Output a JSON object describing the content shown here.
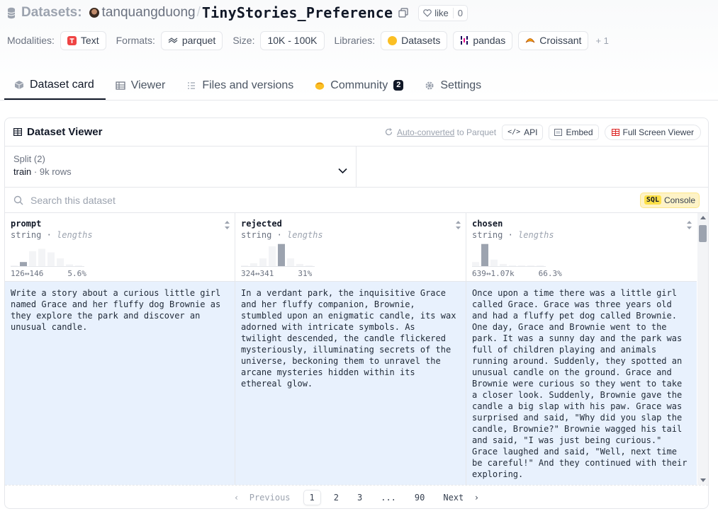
{
  "header": {
    "crumb_label": "Datasets:",
    "owner": "tanquangduong",
    "separator": "/",
    "repo": "TinyStories_Preference",
    "like_label": "like",
    "like_count": "0"
  },
  "meta": {
    "modalities_key": "Modalities:",
    "modalities": [
      "Text"
    ],
    "formats_key": "Formats:",
    "formats": [
      "parquet"
    ],
    "size_key": "Size:",
    "size": "10K - 100K",
    "libraries_key": "Libraries:",
    "libraries": [
      "Datasets",
      "pandas",
      "Croissant"
    ],
    "libraries_more": "+ 1"
  },
  "tabs": [
    {
      "label": "Dataset card",
      "icon": "cube-icon",
      "active": true
    },
    {
      "label": "Viewer",
      "icon": "table-icon"
    },
    {
      "label": "Files and versions",
      "icon": "files-icon"
    },
    {
      "label": "Community",
      "icon": "community-icon",
      "badge": "2"
    },
    {
      "label": "Settings",
      "icon": "gear-icon"
    }
  ],
  "viewer": {
    "title": "Dataset Viewer",
    "auto_link": "Auto-converted",
    "auto_suffix": " to Parquet",
    "api_label": "API",
    "embed_label": "Embed",
    "fullscreen_label": "Full Screen Viewer",
    "split_label": "Split (2)",
    "split_value": "train",
    "split_sep": " · ",
    "split_rows": "9k rows",
    "search_placeholder": "Search this dataset",
    "sql_tag": "SQL",
    "sql_label": "Console"
  },
  "columns": [
    {
      "name": "prompt",
      "type": "string",
      "sub": "lengths",
      "range": "126↔146",
      "pct": "5.6%",
      "hist": [
        0.0,
        0.2,
        0.65,
        0.75,
        0.6,
        0.35,
        0.1,
        0.05
      ],
      "highlight": 1,
      "cell": "Write a story about a curious little girl named Grace and her fluffy dog Brownie as they explore the park and discover an unusual candle."
    },
    {
      "name": "rejected",
      "type": "string",
      "sub": "lengths",
      "range": "324↔341",
      "pct": "31%",
      "hist": [
        0.05,
        0.15,
        0.35,
        0.85,
        0.95,
        0.35,
        0.12,
        0.05
      ],
      "highlight": 4,
      "cell": "In a verdant park, the inquisitive Grace and her fluffy companion, Brownie, stumbled upon an enigmatic candle, its wax adorned with intricate symbols. As twilight descended, the candle flickered mysteriously, illuminating secrets of the universe, beckoning them to unravel the arcane mysteries hidden within its ethereal glow."
    },
    {
      "name": "chosen",
      "type": "string",
      "sub": "lengths",
      "range": "639↔1.07k",
      "pct": "66.3%",
      "hist": [
        0.2,
        0.95,
        0.3,
        0.12,
        0.06,
        0.04,
        0.03,
        0.02
      ],
      "highlight": 1,
      "cell": "Once upon a time there was a little girl called Grace. Grace was three years old and had a fluffy pet dog called Brownie. One day, Grace and Brownie went to the park. It was a sunny day and the park was full of children playing and animals running around. Suddenly, they spotted an unusual candle on the ground. Grace and Brownie were curious so they went to take a closer look. Suddenly, Brownie gave the candle a big slap with his paw. Grace was surprised and said, \"Why did you slap the candle, Brownie?\" Brownie wagged his tail and said, \"I was just being curious.\" Grace laughed and said, \"Well, next time be careful!\" And they continued with their exploring."
    }
  ],
  "pager": {
    "prev": "Previous",
    "pages": [
      "1",
      "2",
      "3",
      "...",
      "90"
    ],
    "active": "1",
    "next": "Next"
  }
}
